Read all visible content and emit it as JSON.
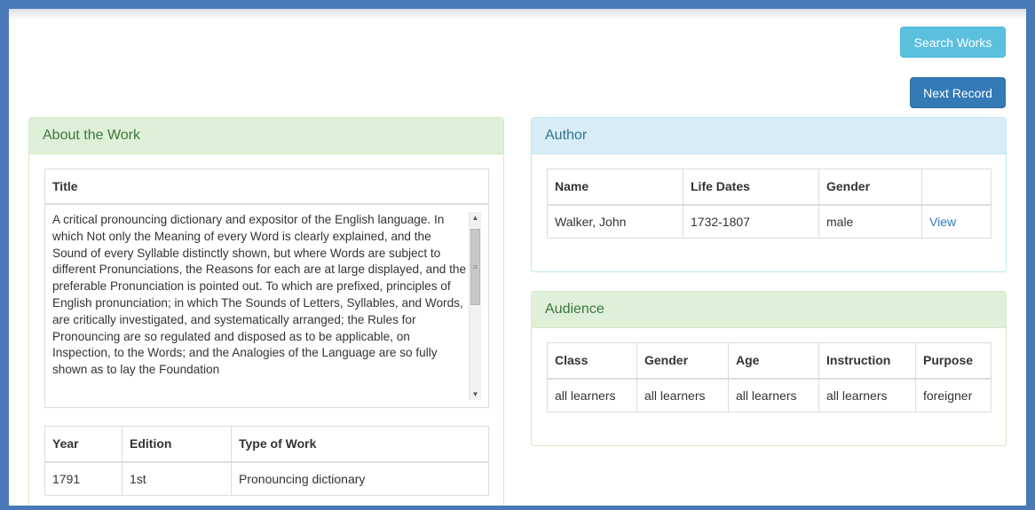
{
  "buttons": {
    "search_works": "Search Works",
    "next_record": "Next Record"
  },
  "work": {
    "heading": "About the Work",
    "title_label": "Title",
    "title_text": "A critical pronouncing dictionary and expositor of the English language. In which Not only the Meaning of every Word is clearly explained, and the Sound of every Syllable distinctly shown, but where Words are subject to different Pronunciations, the Reasons for each are at large displayed, and the preferable Pronunciation is pointed out. To which are prefixed, principles of English pronunciation; in which The Sounds of Letters, Syllables, and Words, are critically investigated, and systematically arranged; the Rules for Pronouncing are so regulated and disposed as to be applicable, on Inspection, to the Words; and the Analogies of the Language are so fully shown as to lay the Foundation",
    "details": {
      "headers": [
        "Year",
        "Edition",
        "Type of Work"
      ],
      "row": [
        "1791",
        "1st",
        "Pronouncing dictionary"
      ]
    }
  },
  "author": {
    "heading": "Author",
    "headers": [
      "Name",
      "Life Dates",
      "Gender",
      ""
    ],
    "row": [
      "Walker, John",
      "1732-1807",
      "male",
      "View"
    ]
  },
  "audience": {
    "heading": "Audience",
    "headers": [
      "Class",
      "Gender",
      "Age",
      "Instruction",
      "Purpose"
    ],
    "row": [
      "all learners",
      "all learners",
      "all learners",
      "all learners",
      "foreigner"
    ]
  },
  "colors": {
    "background": "#4a79b9",
    "info_button": "#5bc0de",
    "primary_button": "#337ab7",
    "success_panel": "#dff0d8",
    "info_panel": "#d9edf7",
    "link": "#337ab7"
  }
}
